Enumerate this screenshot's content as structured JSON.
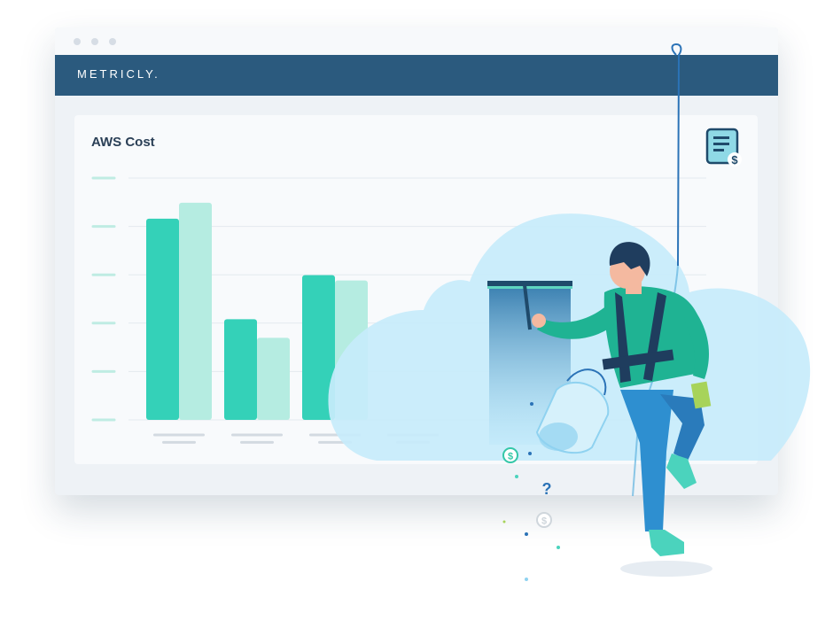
{
  "app": {
    "brand": "METRICLY."
  },
  "card": {
    "title": "AWS Cost"
  },
  "icons": {
    "receipt": "receipt-dollar-icon",
    "dollar": "dollar-coin-icon",
    "question": "question-mark-icon"
  },
  "colors": {
    "appbar": "#2b5a7e",
    "bar_primary": "#34d1b8",
    "bar_secondary": "#b5ece1",
    "cloud": "#c9ecfb",
    "worker_shirt": "#1fb393",
    "worker_pants": "#2e8fd0"
  },
  "chart_data": {
    "type": "bar",
    "categories": [
      "",
      "",
      "",
      ""
    ],
    "series": [
      {
        "values": [
          228,
          114,
          164,
          0
        ]
      },
      {
        "values": [
          246,
          93,
          158,
          0
        ]
      }
    ],
    "title": "AWS Cost",
    "xlabel": "",
    "ylabel": "",
    "ylim": [
      0,
      274
    ],
    "grid": true
  },
  "illustration": {
    "question_glyph": "?"
  }
}
